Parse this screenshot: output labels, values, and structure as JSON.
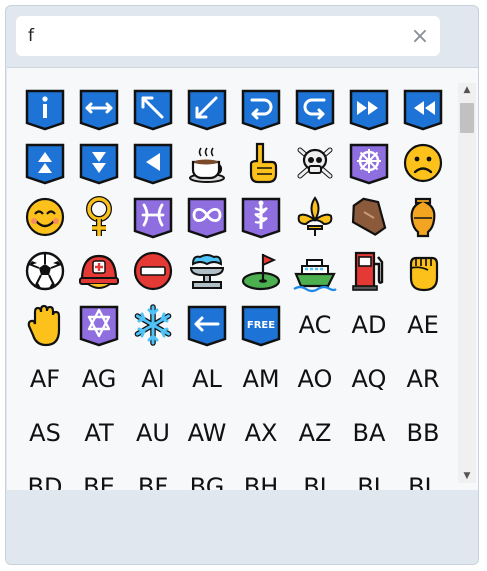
{
  "search": {
    "value": "f",
    "placeholder": ""
  },
  "clear_icon": "×",
  "scrollbar": {
    "up_icon": "▲",
    "down_icon": "▼"
  },
  "colors": {
    "panel": "#e1e7ee",
    "key_blue": "#1e74d6",
    "purple_tile": "#8f6fe0"
  },
  "emoji_grid": [
    {
      "name": "information-icon",
      "kind": "info"
    },
    {
      "name": "left-right-arrow-icon",
      "kind": "lr"
    },
    {
      "name": "up-left-arrow-icon",
      "kind": "ul"
    },
    {
      "name": "down-left-arrow-icon",
      "kind": "dl"
    },
    {
      "name": "right-arrow-curving-left-icon",
      "kind": "rcl"
    },
    {
      "name": "left-arrow-curving-right-icon",
      "kind": "lcr"
    },
    {
      "name": "fast-forward-icon",
      "kind": "ff"
    },
    {
      "name": "fast-reverse-icon",
      "kind": "fr"
    },
    {
      "name": "fast-up-icon",
      "kind": "fu"
    },
    {
      "name": "fast-down-icon",
      "kind": "fd"
    },
    {
      "name": "reverse-icon",
      "kind": "rev"
    },
    {
      "name": "hot-beverage-icon",
      "kind": "coffee"
    },
    {
      "name": "index-pointing-up-icon",
      "kind": "point"
    },
    {
      "name": "skull-crossbones-icon",
      "kind": "skull"
    },
    {
      "name": "wheel-of-dharma-icon",
      "kind": "dharma"
    },
    {
      "name": "frowning-face-icon",
      "kind": "frown"
    },
    {
      "name": "smiling-face-icon",
      "kind": "smile"
    },
    {
      "name": "female-sign-icon",
      "kind": "female"
    },
    {
      "name": "pisces-icon",
      "kind": "pisces"
    },
    {
      "name": "infinity-icon",
      "kind": "infinity"
    },
    {
      "name": "medical-symbol-icon",
      "kind": "medical"
    },
    {
      "name": "fleur-de-lis-icon",
      "kind": "fleur"
    },
    {
      "name": "coffin-icon",
      "kind": "coffin"
    },
    {
      "name": "funeral-urn-icon",
      "kind": "urn"
    },
    {
      "name": "soccer-ball-icon",
      "kind": "soccer"
    },
    {
      "name": "rescue-helmet-icon",
      "kind": "helmet"
    },
    {
      "name": "no-entry-icon",
      "kind": "noentry"
    },
    {
      "name": "fountain-icon",
      "kind": "fountain"
    },
    {
      "name": "flag-in-hole-icon",
      "kind": "golf"
    },
    {
      "name": "ferry-icon",
      "kind": "ferry"
    },
    {
      "name": "fuel-pump-icon",
      "kind": "fuel"
    },
    {
      "name": "raised-fist-icon",
      "kind": "fist"
    },
    {
      "name": "raised-hand-icon",
      "kind": "hand"
    },
    {
      "name": "star-of-david-icon",
      "kind": "david"
    },
    {
      "name": "snowflake-icon",
      "kind": "snow"
    },
    {
      "name": "left-arrow-icon",
      "kind": "leftarrow"
    },
    {
      "name": "free-button-icon",
      "kind": "free",
      "label": "FREE"
    }
  ],
  "flag_codes": [
    "AC",
    "AD",
    "AE",
    "AF",
    "AG",
    "AI",
    "AL",
    "AM",
    "AO",
    "AQ",
    "AR",
    "AS",
    "AT",
    "AU",
    "AW",
    "AX",
    "AZ",
    "BA",
    "BB",
    "BD",
    "BE",
    "BF",
    "BG",
    "BH",
    "BI",
    "BJ",
    "BL"
  ]
}
